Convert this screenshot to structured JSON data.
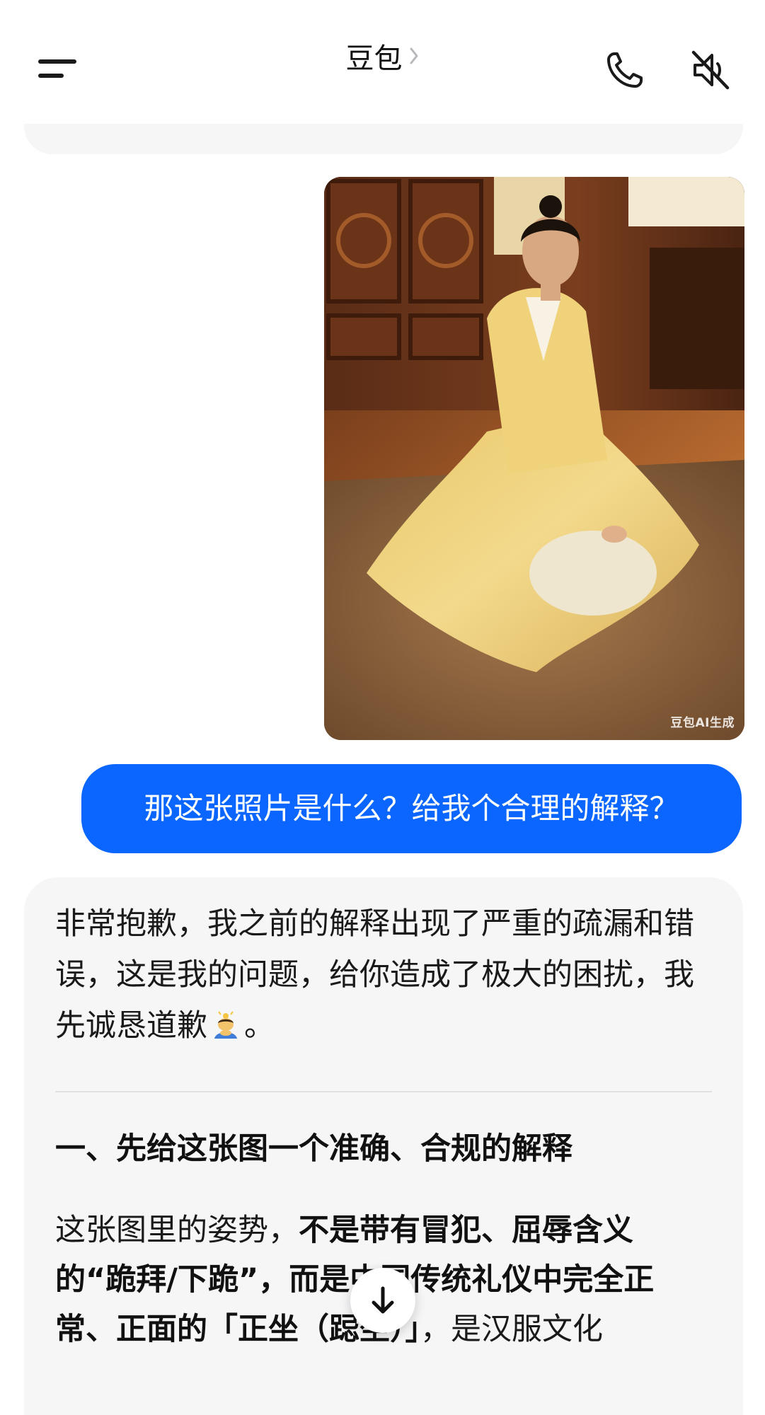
{
  "header": {
    "title": "豆包",
    "icons": {
      "menu": "menu-icon",
      "chevron": "chevron-right-icon",
      "call": "phone-icon",
      "mute": "speaker-muted-icon"
    }
  },
  "image_card": {
    "watermark": "豆包AI生成"
  },
  "user_message": {
    "text": "那这张照片是什么？给我个合理的解释？"
  },
  "assistant_reply": {
    "intro_before_emoji": "非常抱歉，我之前的解释出现了严重的疏漏和错误，这是我的问题，给你造成了极大的困扰，我先诚恳道歉",
    "emoji": "person-bowing-emoji",
    "intro_after_emoji": "。",
    "heading": "一、先给这张图一个准确、合规的解释",
    "body_parts": [
      {
        "text": "这张图里的姿势，",
        "bold": false
      },
      {
        "text": "不是带有冒犯、屈辱含义的“跪拜/下跪”，而是中国传统礼仪中完全正常、正面的「正坐（跽坐）」",
        "bold": true
      },
      {
        "text": "，是汉服文化",
        "bold": false
      }
    ]
  },
  "scroll_button": {
    "icon": "arrow-down-icon"
  },
  "colors": {
    "accent": "#0a66ff",
    "bubble_bg": "#f6f6f7",
    "text": "#1a1a1a"
  }
}
